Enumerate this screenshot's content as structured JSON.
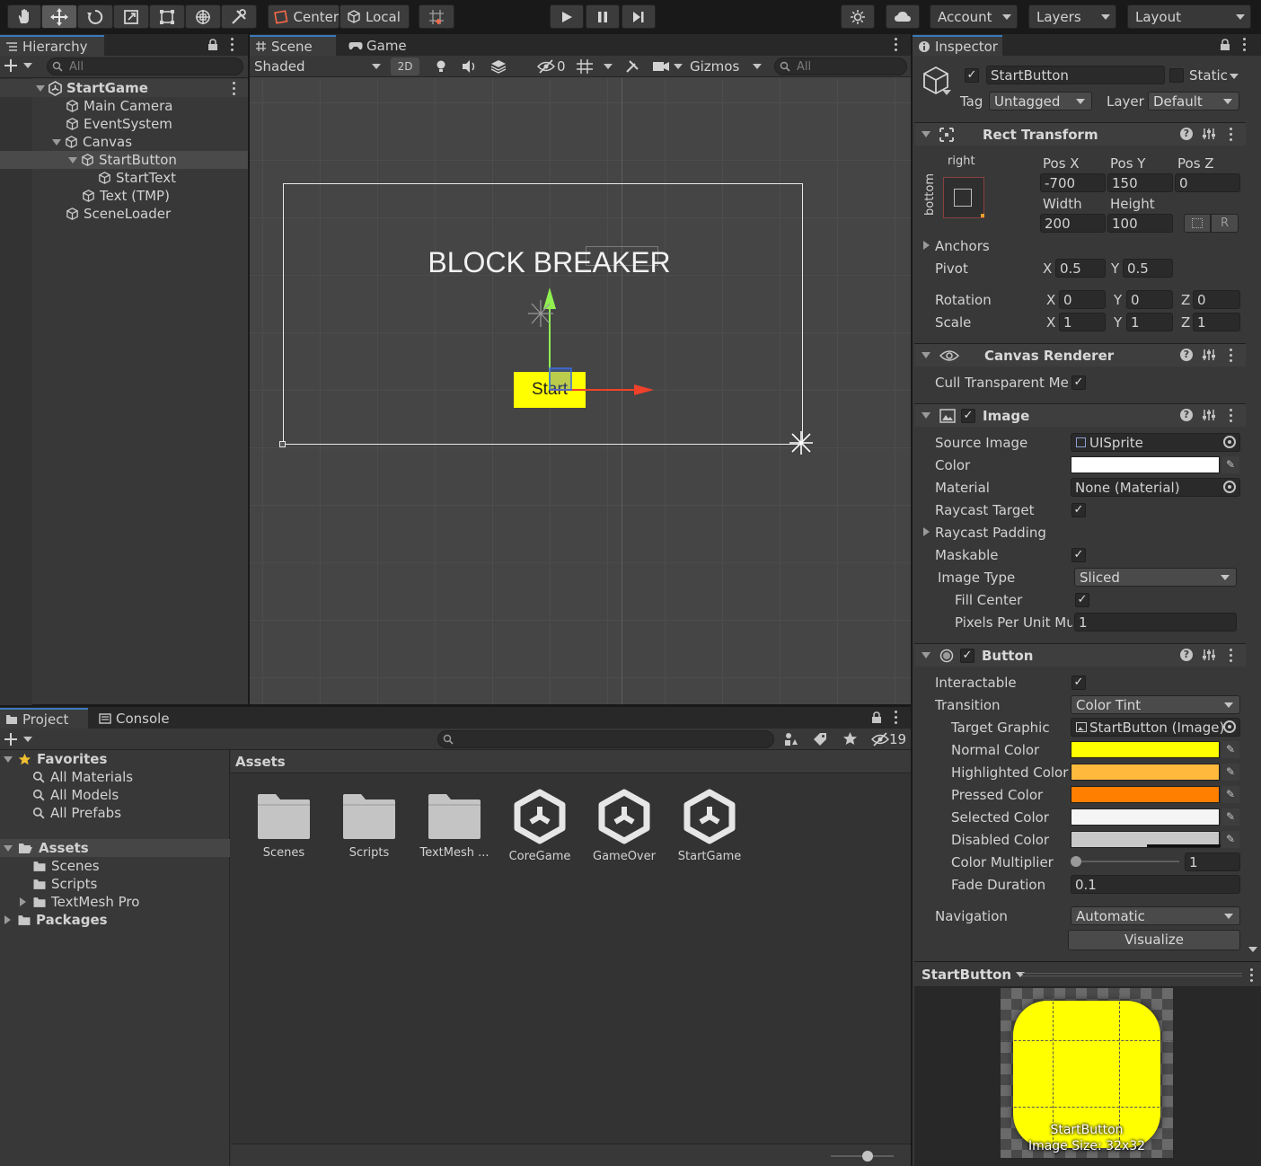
{
  "toolbar": {
    "tools": [
      "hand-tool",
      "move-tool",
      "rotate-tool",
      "scale-tool",
      "rect-tool",
      "transform-tool",
      "custom-tool"
    ],
    "pivot_mode": "Center",
    "pivot_rotation": "Local",
    "account": "Account",
    "layers": "Layers",
    "layout": "Layout"
  },
  "hierarchy": {
    "tab": "Hierarchy",
    "search_placeholder": "All",
    "items": [
      {
        "label": "StartGame",
        "depth": 0
      },
      {
        "label": "Main Camera",
        "depth": 1
      },
      {
        "label": "EventSystem",
        "depth": 1
      },
      {
        "label": "Canvas",
        "depth": 1
      },
      {
        "label": "StartButton",
        "depth": 2
      },
      {
        "label": "StartText",
        "depth": 3
      },
      {
        "label": "Text (TMP)",
        "depth": 2
      },
      {
        "label": "SceneLoader",
        "depth": 1
      }
    ]
  },
  "scene": {
    "tabs": [
      "Scene",
      "Game"
    ],
    "shading": "Shaded",
    "mode_2d": "2D",
    "hidden_count": "0",
    "gizmos": "Gizmos",
    "search_placeholder": "All",
    "title_text": "BLOCK BREAKER",
    "button_text": "Start"
  },
  "inspector": {
    "tab": "Inspector",
    "object_name": "StartButton",
    "static_label": "Static",
    "tag_label": "Tag",
    "tag_value": "Untagged",
    "layer_label": "Layer",
    "layer_value": "Default",
    "rect_transform": {
      "title": "Rect Transform",
      "anchor_h": "right",
      "anchor_v": "bottom",
      "pos_x_label": "Pos X",
      "pos_y_label": "Pos Y",
      "pos_z_label": "Pos Z",
      "pos_x": "-700",
      "pos_y": "150",
      "pos_z": "0",
      "width_label": "Width",
      "height_label": "Height",
      "width": "200",
      "height": "100",
      "raw_label": "R",
      "anchors_label": "Anchors",
      "pivot_label": "Pivot",
      "pivot_x": "0.5",
      "pivot_y": "0.5",
      "rotation_label": "Rotation",
      "rot_x": "0",
      "rot_y": "0",
      "rot_z": "0",
      "scale_label": "Scale",
      "scale_x": "1",
      "scale_y": "1",
      "scale_z": "1",
      "x": "X",
      "y": "Y",
      "z": "Z"
    },
    "canvas_renderer": {
      "title": "Canvas Renderer",
      "cull_label": "Cull Transparent Me:"
    },
    "image": {
      "title": "Image",
      "source_image_label": "Source Image",
      "source_image": "UISprite",
      "color_label": "Color",
      "material_label": "Material",
      "material": "None (Material)",
      "raycast_target_label": "Raycast Target",
      "raycast_padding_label": "Raycast Padding",
      "maskable_label": "Maskable",
      "image_type_label": "Image Type",
      "image_type": "Sliced",
      "fill_center_label": "Fill Center",
      "ppu_label": "Pixels Per Unit Mu",
      "ppu": "1"
    },
    "button": {
      "title": "Button",
      "interactable_label": "Interactable",
      "transition_label": "Transition",
      "transition": "Color Tint",
      "target_graphic_label": "Target Graphic",
      "target_graphic": "StartButton (Image)",
      "normal_label": "Normal Color",
      "highlighted_label": "Highlighted Color",
      "pressed_label": "Pressed Color",
      "selected_label": "Selected Color",
      "disabled_label": "Disabled Color",
      "multiplier_label": "Color Multiplier",
      "multiplier": "1",
      "fade_label": "Fade Duration",
      "fade": "0.1",
      "navigation_label": "Navigation",
      "navigation": "Automatic",
      "visualize": "Visualize"
    },
    "preview": {
      "title": "StartButton",
      "caption_name": "StartButton",
      "caption_size": "Image Size: 32x32"
    }
  },
  "project": {
    "tabs": [
      "Project",
      "Console"
    ],
    "hidden_count": "19",
    "favorites": "Favorites",
    "favorite_items": [
      "All Materials",
      "All Models",
      "All Prefabs"
    ],
    "assets_root": "Assets",
    "asset_folders": [
      "Scenes",
      "Scripts",
      "TextMesh Pro"
    ],
    "packages": "Packages",
    "breadcrumb": "Assets",
    "assets": [
      {
        "name": "Scenes",
        "kind": "folder"
      },
      {
        "name": "Scripts",
        "kind": "folder"
      },
      {
        "name": "TextMesh ...",
        "kind": "folder"
      },
      {
        "name": "CoreGame",
        "kind": "scene"
      },
      {
        "name": "GameOver",
        "kind": "scene"
      },
      {
        "name": "StartGame",
        "kind": "scene"
      }
    ]
  },
  "colors": {
    "accent": "#3a79bb",
    "button_yellow": "#ffff00",
    "normal": "#ffff00",
    "highlighted": "#ffb93c",
    "pressed": "#ff8000",
    "selected": "#f5f5f5",
    "disabled": "#c8c8c8",
    "image_color": "#ffffff"
  }
}
